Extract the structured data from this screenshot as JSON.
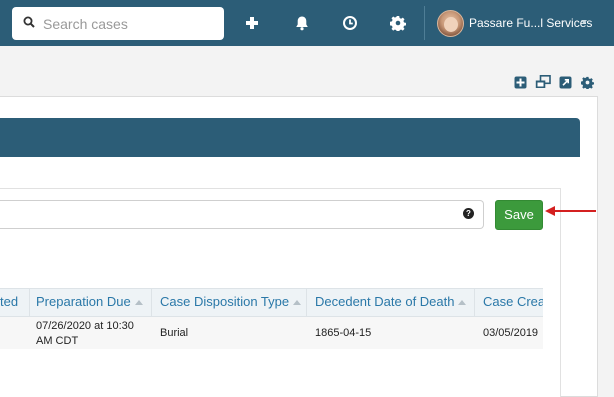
{
  "search": {
    "placeholder": "Search cases"
  },
  "nav": {
    "icons": [
      "plus-icon",
      "bell-icon",
      "clock-icon",
      "gear-icon"
    ],
    "user_name": "Passare Fu...l Services"
  },
  "toolbar": {
    "icons": [
      "add-box-icon",
      "windows-icon",
      "external-link-icon",
      "settings-icon"
    ]
  },
  "form": {
    "filter_value": "",
    "help_label": "?",
    "save_label": "Save"
  },
  "table": {
    "columns": [
      {
        "label": "ted"
      },
      {
        "label": "Preparation Due"
      },
      {
        "label": "Case Disposition Type"
      },
      {
        "label": "Decedent Date of Death"
      },
      {
        "label": "Case Creat"
      }
    ],
    "rows": [
      {
        "preparation_due_line1": "07/26/2020 at 10:30",
        "preparation_due_line2": "AM CDT",
        "disposition_type": "Burial",
        "date_of_death": "1865-04-15",
        "case_created": "03/05/2019"
      }
    ]
  },
  "colors": {
    "navbar": "#2c5d77",
    "save_button": "#3c9a3c",
    "link_header": "#2a78a8",
    "annotation_arrow": "#d42020"
  }
}
